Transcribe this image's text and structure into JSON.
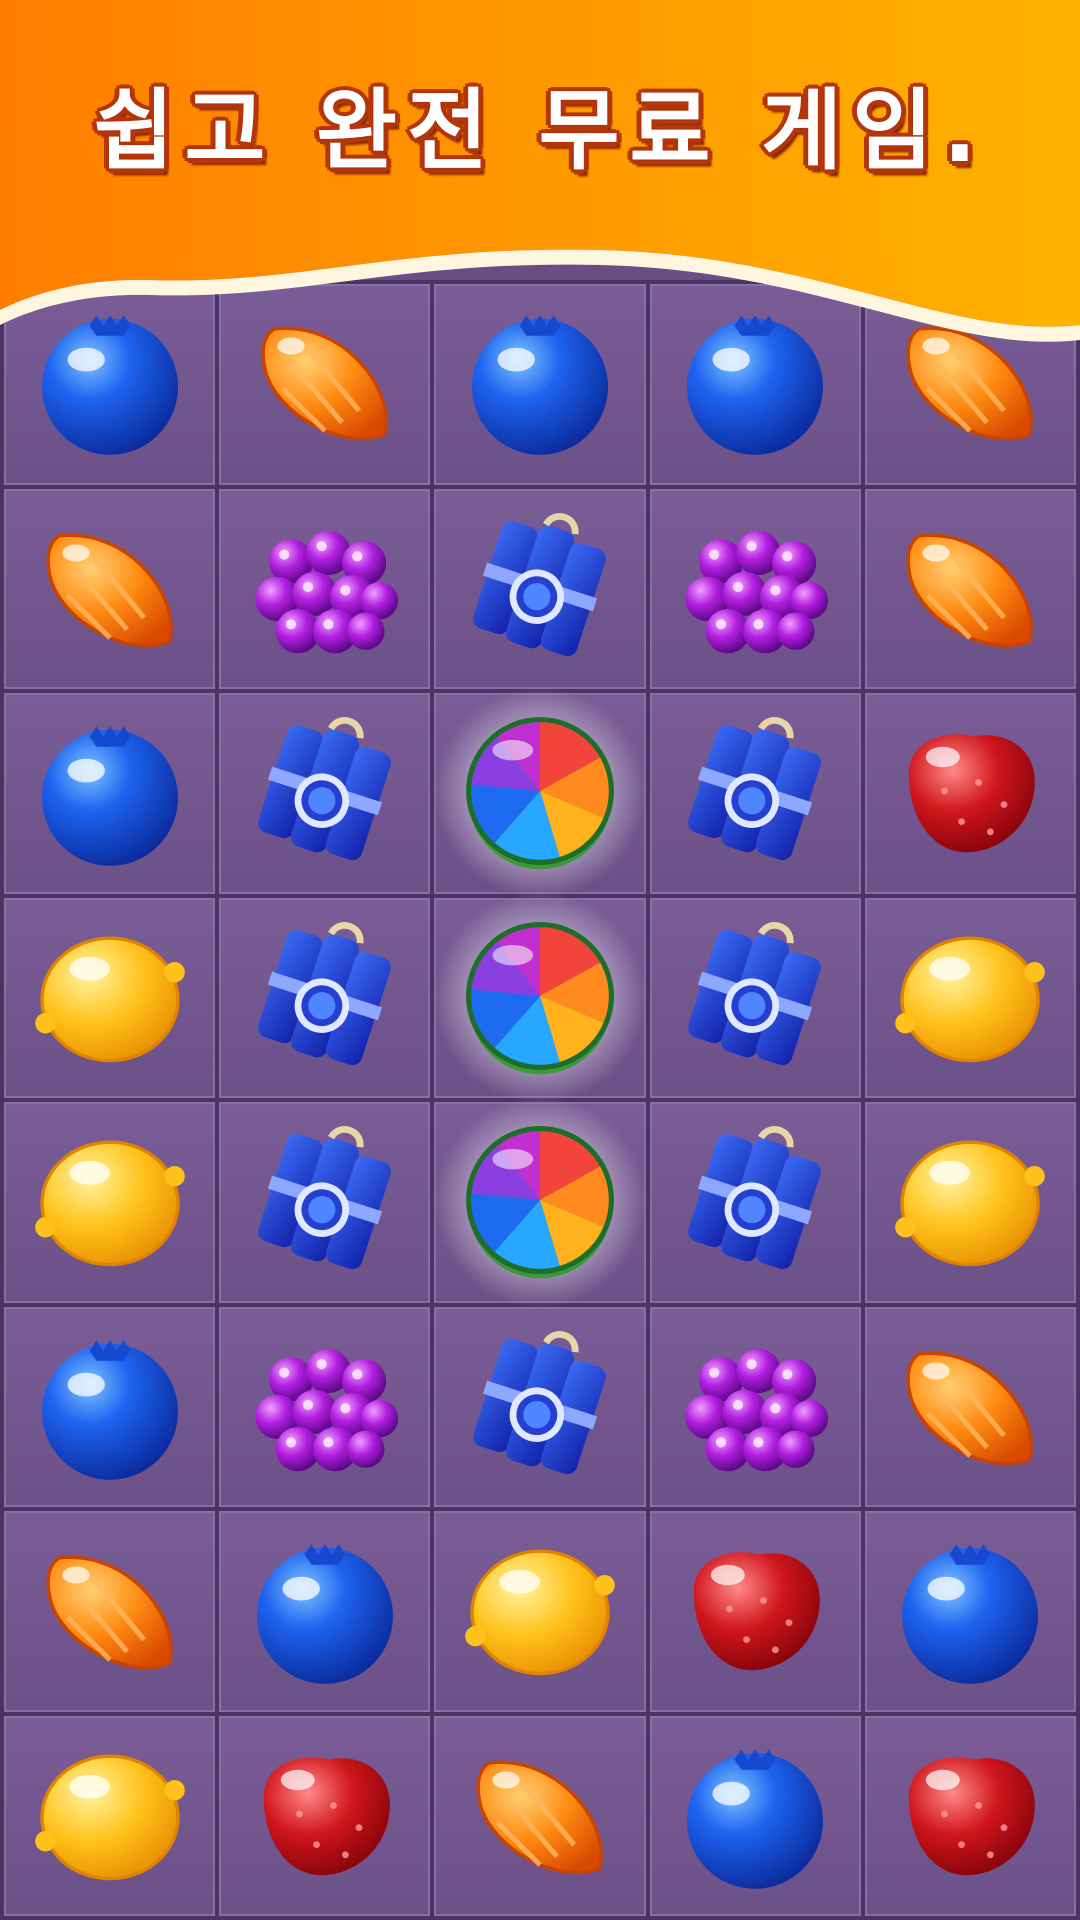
{
  "banner": {
    "title": "쉽고 완전 무료 게임."
  },
  "colors": {
    "banner_orange": "#ff8a00",
    "banner_yellow": "#ffb400",
    "board_purple": "#6b4d86"
  },
  "board": {
    "columns": 5,
    "rows": 8,
    "tiles": [
      [
        "blueberry-icon",
        "orange-slice-icon",
        "blueberry-icon",
        "blueberry-icon",
        "orange-slice-icon"
      ],
      [
        "orange-slice-icon",
        "grape-icon",
        "blueberry-bomb-icon",
        "grape-icon",
        "orange-slice-icon"
      ],
      [
        "blueberry-icon",
        "blueberry-bomb-icon",
        "rainbow-wheel-icon",
        "blueberry-bomb-icon",
        "strawberry-icon"
      ],
      [
        "lemon-icon",
        "blueberry-bomb-icon",
        "rainbow-wheel-icon",
        "blueberry-bomb-icon",
        "lemon-icon"
      ],
      [
        "lemon-icon",
        "blueberry-bomb-icon",
        "rainbow-wheel-icon",
        "blueberry-bomb-icon",
        "lemon-icon"
      ],
      [
        "blueberry-icon",
        "grape-icon",
        "blueberry-bomb-icon",
        "grape-icon",
        "orange-slice-icon"
      ],
      [
        "orange-slice-icon",
        "blueberry-icon",
        "lemon-icon",
        "strawberry-icon",
        "blueberry-icon"
      ],
      [
        "lemon-icon",
        "strawberry-icon",
        "orange-slice-icon",
        "blueberry-icon",
        "strawberry-icon"
      ]
    ]
  }
}
